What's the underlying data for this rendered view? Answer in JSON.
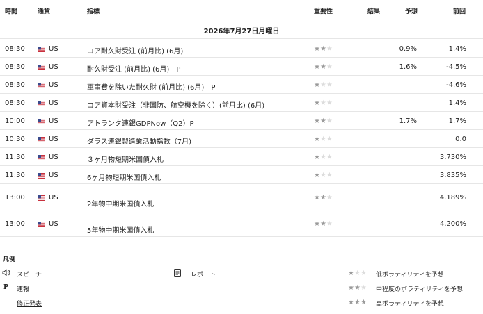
{
  "header": {
    "time": "時間",
    "currency": "通貨",
    "indicator": "指標",
    "importance": "重要性",
    "actual": "結果",
    "forecast": "予想",
    "previous": "前回"
  },
  "date": "2026年7月27日月曜日",
  "events": [
    {
      "time": "08:30",
      "country": "US",
      "indicator": "コア耐久財受注 (前月比) (6月)",
      "importance": 2,
      "forecast": "0.9%",
      "previous": "1.4%"
    },
    {
      "time": "08:30",
      "country": "US",
      "indicator": "耐久財受注 (前月比) (6月)　P",
      "importance": 2,
      "forecast": "1.6%",
      "previous": "-4.5%"
    },
    {
      "time": "08:30",
      "country": "US",
      "indicator": "軍事費を除いた耐久財 (前月比) (6月)　P",
      "importance": 1,
      "forecast": "",
      "previous": "-4.6%"
    },
    {
      "time": "08:30",
      "country": "US",
      "indicator": "コア資本財受注（非国防、航空機を除く）(前月比) (6月)",
      "importance": 1,
      "forecast": "",
      "previous": "1.4%"
    },
    {
      "time": "10:00",
      "country": "US",
      "indicator": "アトランタ連銀GDPNow（Q2）P",
      "importance": 2,
      "forecast": "1.7%",
      "previous": "1.7%"
    },
    {
      "time": "10:30",
      "country": "US",
      "indicator": "ダラス連銀製造業活動指数（7月)",
      "importance": 1,
      "forecast": "",
      "previous": "0.0"
    },
    {
      "time": "11:30",
      "country": "US",
      "indicator": "３ヶ月物短期米国債入札",
      "importance": 1,
      "forecast": "",
      "previous": "3.730%"
    },
    {
      "time": "11:30",
      "country": "US",
      "indicator": "6ヶ月物短期米国債入札",
      "importance": 1,
      "forecast": "",
      "previous": "3.835%"
    },
    {
      "time": "13:00",
      "country": "US",
      "indicator": "2年物中期米国債入札",
      "importance": 2,
      "forecast": "",
      "previous": "4.189%"
    },
    {
      "time": "13:00",
      "country": "US",
      "indicator": "5年物中期米国債入札",
      "importance": 2,
      "forecast": "",
      "previous": "4.200%"
    }
  ],
  "legend": {
    "title": "凡例",
    "speech": "スピーチ",
    "preliminary_symbol": "P",
    "preliminary": "速報",
    "revised": "修正発表",
    "report": "レポート",
    "low": "低ボラティリティを予想",
    "medium": "中程度のボラティリティを予想",
    "high": "高ボラティリティを予想"
  },
  "colors": {
    "star_on": "#9b9b9b",
    "star_off": "#dddddd",
    "divider": "#e6e6e6"
  },
  "icons": {
    "flag": "us-flag-icon",
    "speech": "speaker-icon",
    "report": "document-icon",
    "star": "star-icon"
  }
}
